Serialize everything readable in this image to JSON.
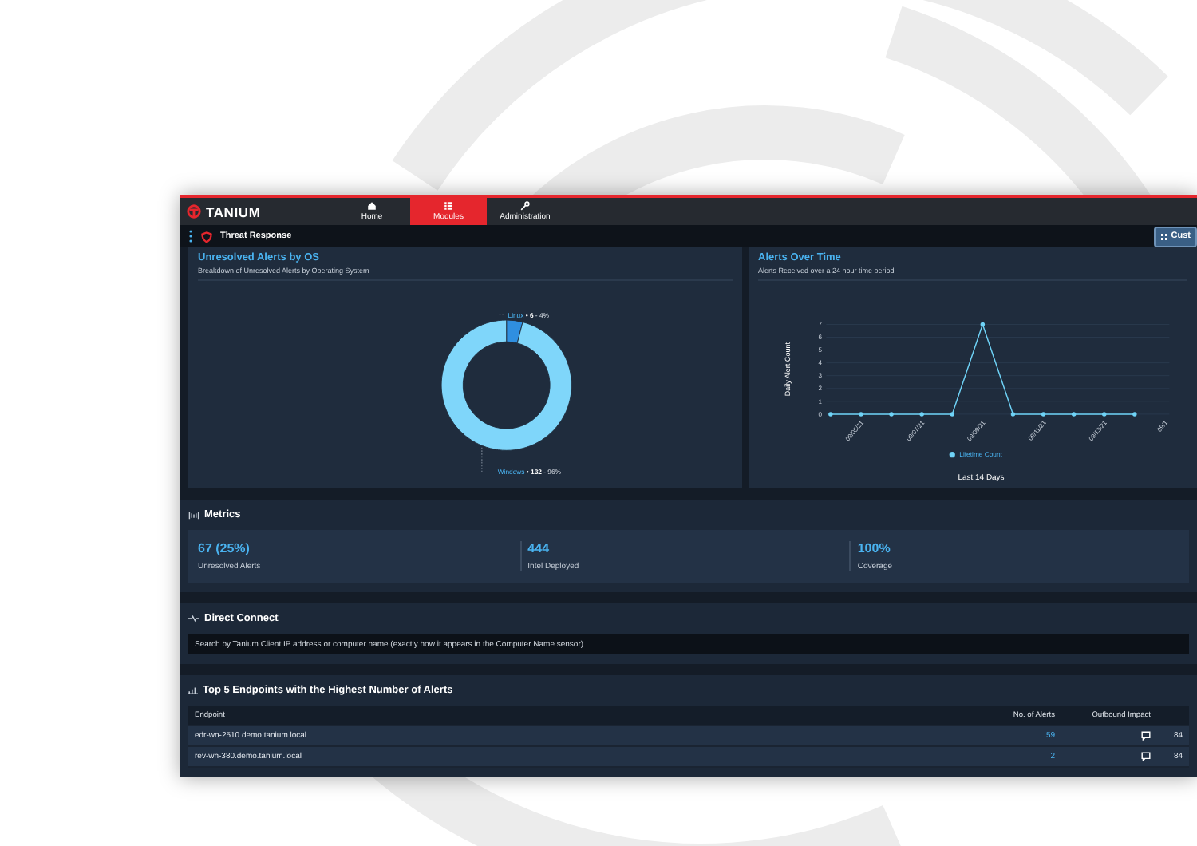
{
  "nav": {
    "brand": "TANIUM",
    "items": [
      {
        "label": "Home",
        "selected": false
      },
      {
        "label": "Modules",
        "selected": true
      },
      {
        "label": "Administration",
        "selected": false
      }
    ]
  },
  "subheader": {
    "title": "Threat Response",
    "button": "Cust"
  },
  "os_card": {
    "title": "Unresolved Alerts by OS",
    "subtitle": "Breakdown of Unresolved Alerts by Operating System",
    "labels": [
      {
        "value": "• 6",
        "percent": "- 4%"
      },
      {
        "value": "• 132",
        "percent": "- 96%"
      }
    ],
    "chart_data": {
      "type": "donut",
      "categories": [
        "Linux",
        "Windows"
      ],
      "values": [
        4,
        96
      ]
    }
  },
  "alerts_card": {
    "title": "Alerts Over Time",
    "subtitle": "Alerts Received over a 24 hour time period",
    "chart_data": {
      "type": "line",
      "xlabel": "Last 14 Days",
      "ylabel": "Daily Alert Count",
      "grid": true,
      "ylim": [
        0,
        7
      ],
      "yticks": [
        0,
        1,
        2,
        3,
        4,
        5,
        6,
        7
      ],
      "categories": [
        null,
        "09/05/21",
        null,
        "09/07/21",
        null,
        "09/09/21",
        null,
        "09/11/21",
        null,
        "09/13/21",
        null,
        "09/1"
      ],
      "series": [
        {
          "name": "Lifetime Count",
          "color": "#6fd3f7",
          "values": [
            0,
            0,
            0,
            0,
            0,
            7,
            0,
            0,
            0,
            0,
            0,
            null
          ]
        }
      ]
    }
  },
  "metrics": {
    "title": "Metrics",
    "items": [
      {
        "value": "67 (25%)",
        "label": "Unresolved Alerts"
      },
      {
        "value": "444",
        "label": "Intel Deployed"
      },
      {
        "value": "100%",
        "label": "Coverage"
      }
    ]
  },
  "direct_connect": {
    "title": "Direct Connect",
    "placeholder": "Search by Tanium Client IP address or computer name (exactly how it appears in the Computer Name sensor)"
  },
  "top_endpoints": {
    "title": "Top 5 Endpoints with the Highest Number of Alerts",
    "columns": [
      "Endpoint",
      "No. of Alerts",
      "Outbound Impact"
    ],
    "rows": [
      {
        "endpoint": "edr-wn-2510.demo.tanium.local",
        "alerts": "59",
        "impact": "84"
      },
      {
        "endpoint": "rev-wn-380.demo.tanium.local",
        "alerts": "2",
        "impact": "84"
      }
    ]
  }
}
